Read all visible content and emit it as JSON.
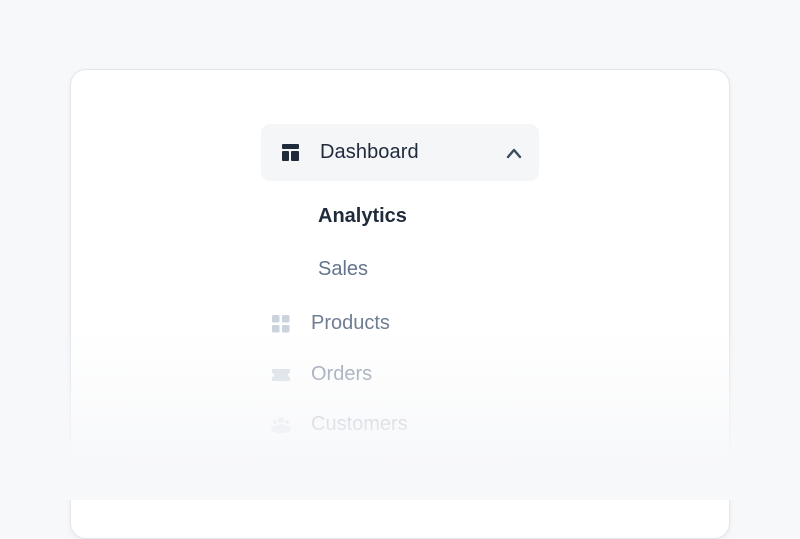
{
  "nav": {
    "dashboard": {
      "label": "Dashboard",
      "icon": "layout-icon",
      "expanded": true,
      "children": [
        {
          "label": "Analytics",
          "active": true
        },
        {
          "label": "Sales",
          "active": false
        }
      ]
    },
    "items": [
      {
        "label": "Products",
        "icon": "grid-icon"
      },
      {
        "label": "Orders",
        "icon": "ticket-icon"
      },
      {
        "label": "Customers",
        "icon": "users-icon"
      }
    ]
  },
  "colors": {
    "page_bg": "#f7f8fa",
    "card_bg": "#ffffff",
    "active_text": "#1f2a3b",
    "muted_text": "#64748b",
    "hover_bg": "#f5f6f8"
  }
}
